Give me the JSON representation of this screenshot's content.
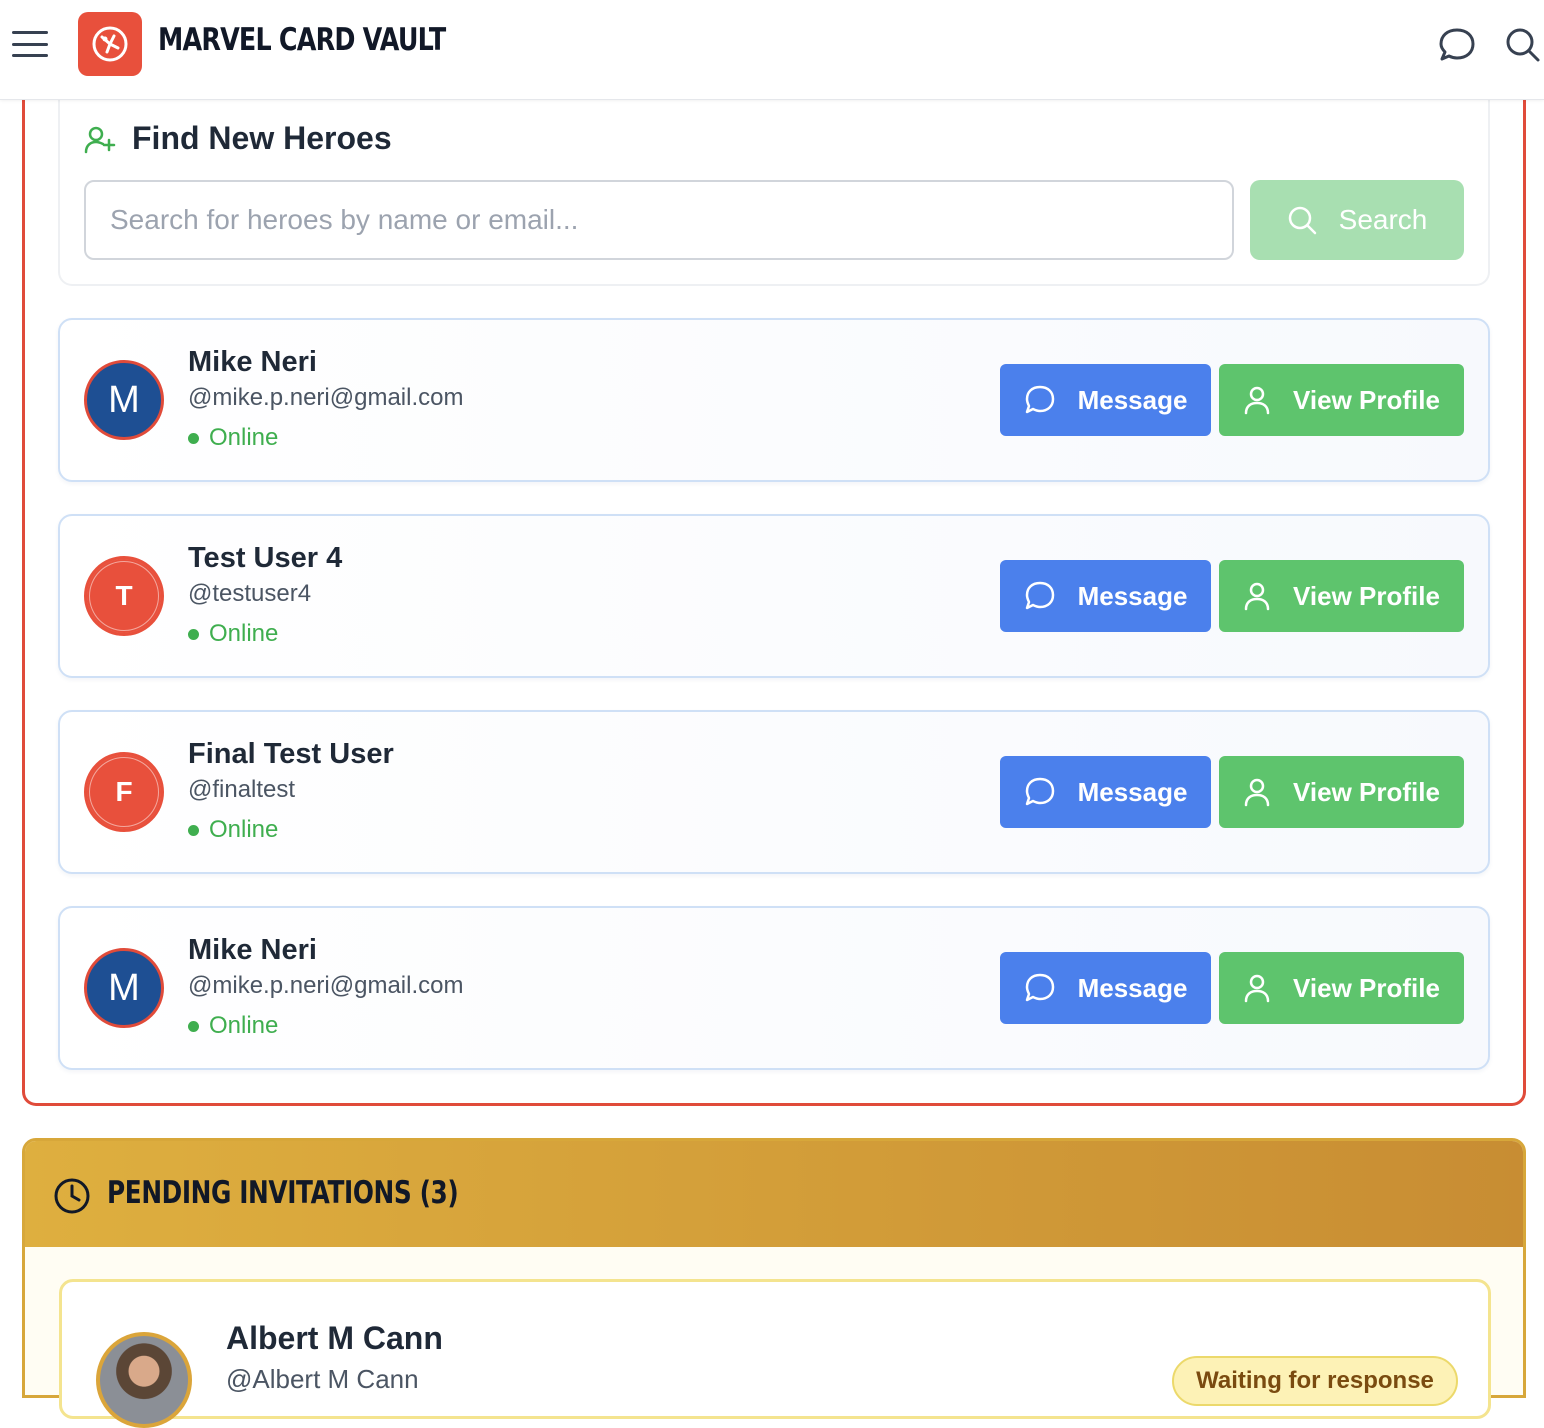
{
  "header": {
    "title": "MARVEL CARD VAULT",
    "menu_icon": "hamburger-menu-icon",
    "logo_icon": "hero-logo-icon",
    "chat_icon": "chat-bubble-icon",
    "search_icon": "search-icon"
  },
  "find": {
    "title": "Find New Heroes",
    "icon": "user-plus-icon",
    "search_placeholder": "Search for heroes by name or email...",
    "search_value": "",
    "search_button": "Search"
  },
  "users": [
    {
      "initial": "M",
      "name": "Mike Neri",
      "handle": "@mike.p.neri@gmail.com",
      "status": "Online",
      "message_label": "Message",
      "profile_label": "View Profile"
    },
    {
      "initial": "T",
      "name": "Test User 4",
      "handle": "@testuser4",
      "status": "Online",
      "message_label": "Message",
      "profile_label": "View Profile"
    },
    {
      "initial": "F",
      "name": "Final Test User",
      "handle": "@finaltest",
      "status": "Online",
      "message_label": "Message",
      "profile_label": "View Profile"
    },
    {
      "initial": "M",
      "name": "Mike Neri",
      "handle": "@mike.p.neri@gmail.com",
      "status": "Online",
      "message_label": "Message",
      "profile_label": "View Profile"
    }
  ],
  "pending": {
    "title": "PENDING INVITATIONS (3)",
    "icon": "clock-icon",
    "invitations": [
      {
        "name": "Albert M Cann",
        "handle": "@Albert M Cann",
        "badge": "Waiting for response"
      }
    ]
  },
  "colors": {
    "accent_red": "#e8503c",
    "message_blue": "#4b80ec",
    "profile_green": "#5ec46d",
    "online_green": "#3fae4f",
    "pending_gold": "#d7a73a"
  }
}
